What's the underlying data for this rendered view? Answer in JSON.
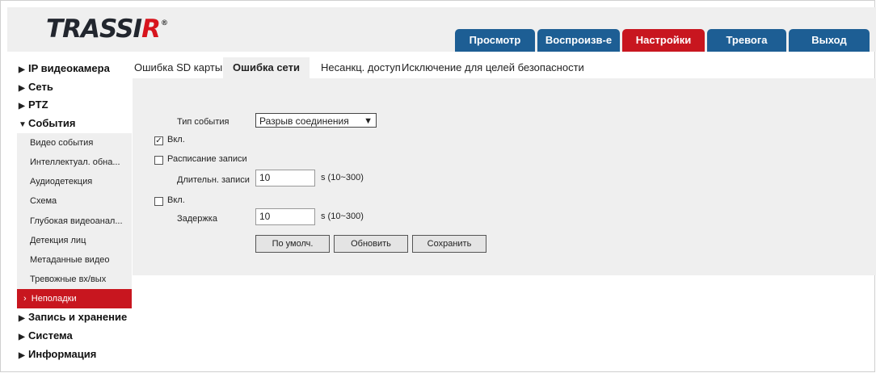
{
  "brand": {
    "logo_main": "TRASSI",
    "logo_accent": "R",
    "logo_mark": "®"
  },
  "nav": {
    "tabs": [
      {
        "label": "Просмотр",
        "active": false
      },
      {
        "label": "Воспроизв-е",
        "active": false
      },
      {
        "label": "Настройки",
        "active": true
      },
      {
        "label": "Тревога",
        "active": false
      },
      {
        "label": "Выход",
        "active": false
      }
    ]
  },
  "sidebar": {
    "items": [
      {
        "label": "IP видеокамера",
        "icon": "triangle-right-icon",
        "expanded": false
      },
      {
        "label": "Сеть",
        "icon": "triangle-right-icon",
        "expanded": false
      },
      {
        "label": "PTZ",
        "icon": "triangle-right-icon",
        "expanded": false
      },
      {
        "label": "События",
        "icon": "triangle-down-icon",
        "expanded": true
      },
      {
        "label": "Запись и хранение",
        "icon": "triangle-right-icon",
        "expanded": false
      },
      {
        "label": "Система",
        "icon": "triangle-right-icon",
        "expanded": false
      },
      {
        "label": "Информация",
        "icon": "triangle-right-icon",
        "expanded": false
      }
    ],
    "subitems": [
      {
        "label": "Видео события",
        "active": false
      },
      {
        "label": "Интеллектуал. обна...",
        "active": false
      },
      {
        "label": "Аудиодетекция",
        "active": false
      },
      {
        "label": "Схема",
        "active": false
      },
      {
        "label": "Глубокая видеоанал...",
        "active": false
      },
      {
        "label": "Детекция лиц",
        "active": false
      },
      {
        "label": "Метаданные видео",
        "active": false
      },
      {
        "label": "Тревожные вх/вых",
        "active": false
      },
      {
        "label": "Неполадки",
        "active": true
      }
    ]
  },
  "content": {
    "tabs": [
      {
        "label": "Ошибка SD карты",
        "active": false
      },
      {
        "label": "Ошибка сети",
        "active": true
      },
      {
        "label": "Несанкц. доступ",
        "active": false
      },
      {
        "label": "Исключение для целей безопасности",
        "active": false
      }
    ],
    "form": {
      "event_type_label": "Тип события",
      "event_type_value": "Разрыв соединения",
      "enable1_label": "Вкл.",
      "enable1_checked": true,
      "schedule_label": "Расписание записи",
      "schedule_checked": false,
      "duration_label": "Длительн. записи",
      "duration_value": "10",
      "duration_hint": "s (10~300)",
      "enable2_label": "Вкл.",
      "enable2_checked": false,
      "delay_label": "Задержка",
      "delay_value": "10",
      "delay_hint": "s (10~300)"
    },
    "buttons": {
      "default_label": "По умолч.",
      "refresh_label": "Обновить",
      "save_label": "Сохранить"
    }
  },
  "colors": {
    "brand_blue": "#1d5e94",
    "brand_red": "#c8161f",
    "panel_bg": "#efefef"
  }
}
